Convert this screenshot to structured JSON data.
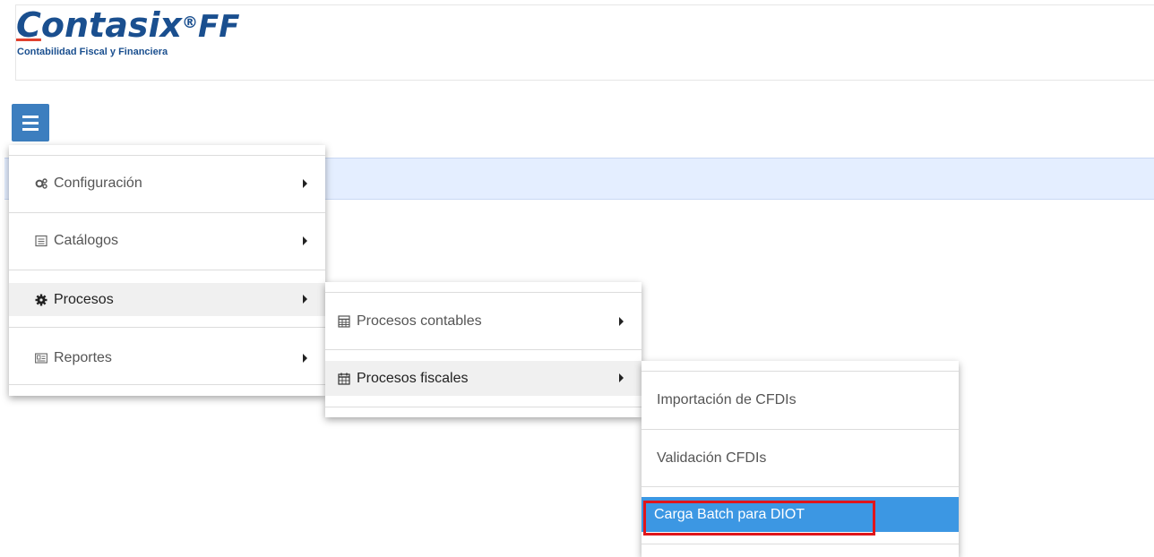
{
  "brand": {
    "logo_c": "C",
    "logo_mid": "ontasix",
    "logo_reg": "®",
    "logo_ff": "FF",
    "tagline": "Contabilidad Fiscal y Financiera"
  },
  "menu_level1": [
    {
      "label": "Configuración",
      "icon": "gears-icon"
    },
    {
      "label": "Catálogos",
      "icon": "list-icon"
    },
    {
      "label": "Procesos",
      "icon": "gear-icon"
    },
    {
      "label": "Reportes",
      "icon": "id-card-icon"
    }
  ],
  "menu_level2": [
    {
      "label": "Procesos contables",
      "icon": "table-icon"
    },
    {
      "label": "Procesos fiscales",
      "icon": "calendar-icon"
    }
  ],
  "menu_level3": [
    {
      "label": "Importación de CFDIs"
    },
    {
      "label": "Validación CFDIs"
    },
    {
      "label": "Carga Batch para DIOT"
    }
  ],
  "colors": {
    "accent": "#3c7ebf",
    "highlight": "#3c97e3",
    "annotation": "#e0151a"
  }
}
